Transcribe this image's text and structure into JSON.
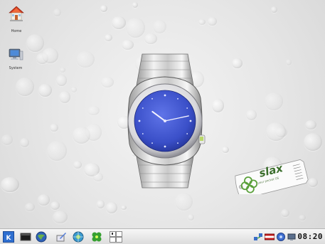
{
  "desktop": {
    "icons": [
      {
        "label": "Home"
      },
      {
        "label": "System"
      }
    ]
  },
  "watch": {
    "face_color": "#3a4fc8",
    "hour_hand_hours": 10,
    "minute_hand_minutes": 13
  },
  "slax_tag": {
    "brand": "slax",
    "tagline": "your pocket OS"
  },
  "taskbar": {
    "launchers": [
      "kde-menu-icon",
      "terminal-icon",
      "network-icon",
      "editor-icon",
      "web-browser-icon",
      "game-icon",
      "pager-icon"
    ],
    "tray": [
      "network-tray-icon",
      "keyboard-layout-icon",
      "volume-icon",
      "display-icon"
    ],
    "clock": "08:20"
  },
  "colors": {
    "watch_face": "#3a4fc8",
    "slax_green": "#3b6e2c",
    "taskbar_bg": "#e6e6e6"
  }
}
